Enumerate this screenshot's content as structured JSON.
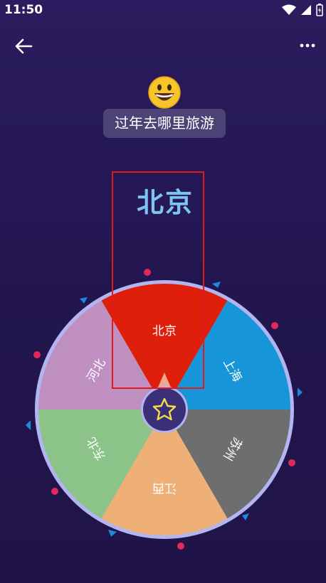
{
  "status": {
    "time": "11:50"
  },
  "header": {
    "back": "back",
    "more": "more"
  },
  "title": "过年去哪里旅游",
  "result": "北京",
  "wheel": {
    "slices": [
      {
        "label": "北京",
        "color": "#de1f0c"
      },
      {
        "label": "上海",
        "color": "#1696d8"
      },
      {
        "label": "苏州",
        "color": "#6e6e6e"
      },
      {
        "label": "江西",
        "color": "#eeb077"
      },
      {
        "label": "东北",
        "color": "#8bc389"
      },
      {
        "label": "河北",
        "color": "#be8fbf"
      }
    ],
    "rim_color": "#b3b5f3",
    "center_icon": "star-icon"
  }
}
